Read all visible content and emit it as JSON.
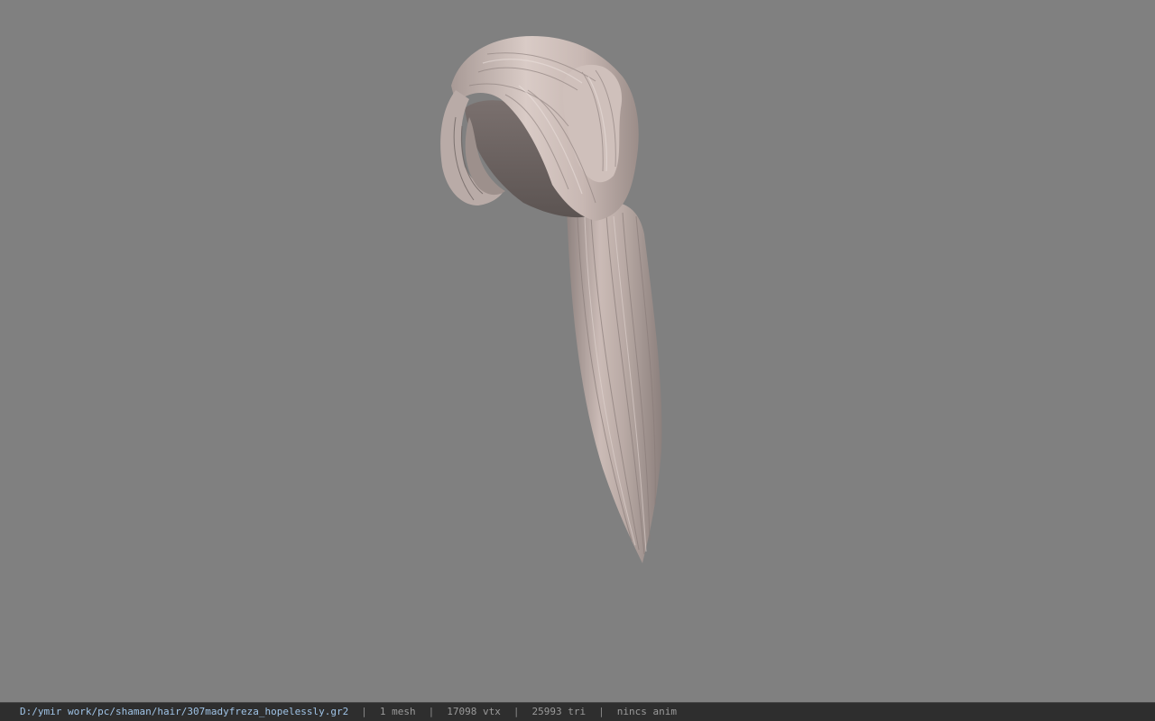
{
  "viewport": {
    "background": "#808080",
    "model": "hair-mesh"
  },
  "statusbar": {
    "file_path": "D:/ymir work/pc/shaman/hair/307madyfreza_hopelessly.gr2",
    "mesh_count": "1 mesh",
    "vertex_count": "17098 vtx",
    "triangle_count": "25993 tri",
    "anim_status": "nincs anim",
    "separator": "|",
    "path_color": "#9fc3e6"
  }
}
